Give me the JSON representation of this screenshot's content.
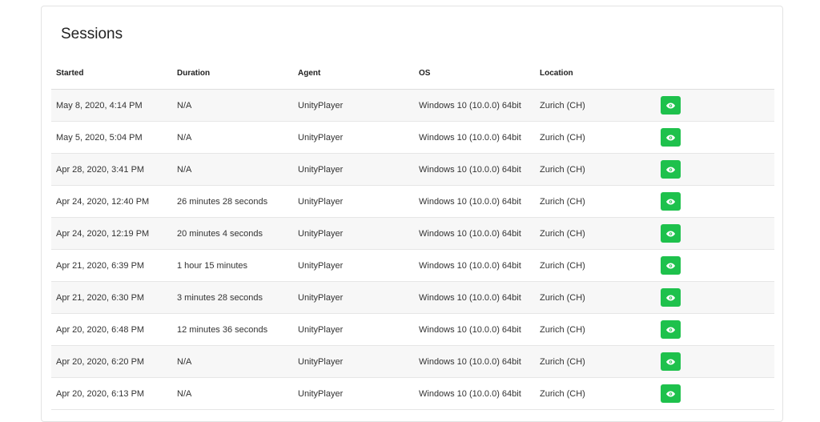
{
  "panel": {
    "title": "Sessions"
  },
  "table": {
    "columns": [
      "Started",
      "Duration",
      "Agent",
      "OS",
      "Location"
    ],
    "rows": [
      {
        "started": "May 8, 2020, 4:14 PM",
        "duration": "N/A",
        "agent": "UnityPlayer",
        "os": "Windows 10 (10.0.0) 64bit",
        "location": "Zurich (CH)"
      },
      {
        "started": "May 5, 2020, 5:04 PM",
        "duration": "N/A",
        "agent": "UnityPlayer",
        "os": "Windows 10 (10.0.0) 64bit",
        "location": "Zurich (CH)"
      },
      {
        "started": "Apr 28, 2020, 3:41 PM",
        "duration": "N/A",
        "agent": "UnityPlayer",
        "os": "Windows 10 (10.0.0) 64bit",
        "location": "Zurich (CH)"
      },
      {
        "started": "Apr 24, 2020, 12:40 PM",
        "duration": "26 minutes 28 seconds",
        "agent": "UnityPlayer",
        "os": "Windows 10 (10.0.0) 64bit",
        "location": "Zurich (CH)"
      },
      {
        "started": "Apr 24, 2020, 12:19 PM",
        "duration": "20 minutes 4 seconds",
        "agent": "UnityPlayer",
        "os": "Windows 10 (10.0.0) 64bit",
        "location": "Zurich (CH)"
      },
      {
        "started": "Apr 21, 2020, 6:39 PM",
        "duration": "1 hour 15 minutes",
        "agent": "UnityPlayer",
        "os": "Windows 10 (10.0.0) 64bit",
        "location": "Zurich (CH)"
      },
      {
        "started": "Apr 21, 2020, 6:30 PM",
        "duration": "3 minutes 28 seconds",
        "agent": "UnityPlayer",
        "os": "Windows 10 (10.0.0) 64bit",
        "location": "Zurich (CH)"
      },
      {
        "started": "Apr 20, 2020, 6:48 PM",
        "duration": "12 minutes 36 seconds",
        "agent": "UnityPlayer",
        "os": "Windows 10 (10.0.0) 64bit",
        "location": "Zurich (CH)"
      },
      {
        "started": "Apr 20, 2020, 6:20 PM",
        "duration": "N/A",
        "agent": "UnityPlayer",
        "os": "Windows 10 (10.0.0) 64bit",
        "location": "Zurich (CH)"
      },
      {
        "started": "Apr 20, 2020, 6:13 PM",
        "duration": "N/A",
        "agent": "UnityPlayer",
        "os": "Windows 10 (10.0.0) 64bit",
        "location": "Zurich (CH)"
      }
    ],
    "row_action_icon": "eye-icon"
  },
  "colors": {
    "accent": "#1ec14c",
    "row_stripe": "#f7f7f7",
    "border": "#e3e3e3"
  }
}
